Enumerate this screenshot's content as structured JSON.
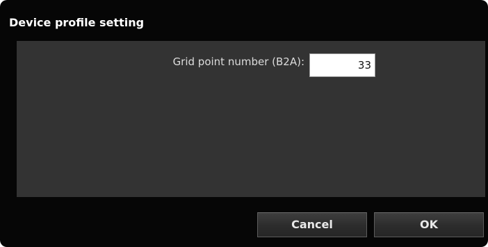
{
  "dialog": {
    "title": "Device profile setting",
    "grid_point": {
      "label": "Grid point number (B2A):",
      "value": "33"
    },
    "buttons": {
      "cancel_label": "Cancel",
      "ok_label": "OK"
    }
  }
}
